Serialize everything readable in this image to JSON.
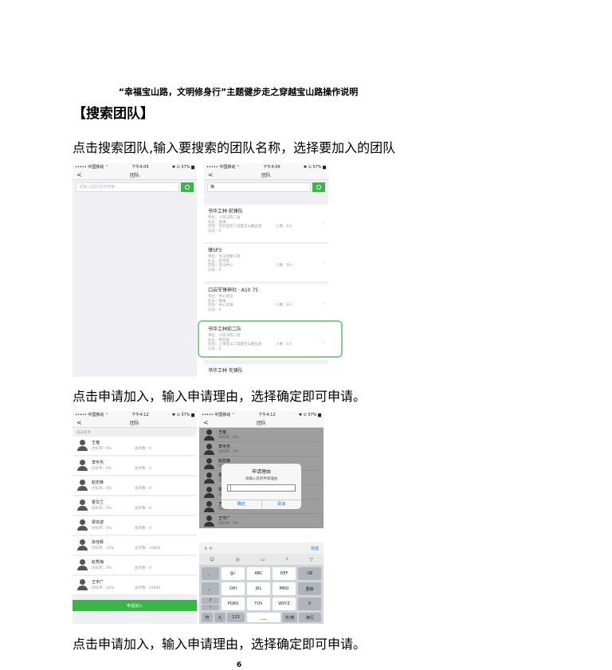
{
  "doc": {
    "title": "“幸福宝山路，文明修身行”主题健步走之穿越宝山路操作说明",
    "section_heading": "【搜索团队】",
    "para1": "点击搜索团队,输入要搜索的团队名称，选择要加入的团队",
    "para2": "点击申请加入，输入申请理由，选择确定即可申请。",
    "para3": "点击申请加入，输入申请理由，选择确定即可申请。",
    "page_number": "6"
  },
  "screen1": {
    "status_left": "••••• 中国移动 ⌃",
    "status_mid": "下午4:05",
    "status_right": "✱ ⊙ 57% ▆",
    "nav_title": "团队",
    "back": "<",
    "search_placeholder": "请输入团队名称搜索..."
  },
  "screen2": {
    "status_left": "••••• 中国移动 ⌃",
    "status_mid": "下午4:06",
    "status_right": "✱ ⊙ 57% ▆",
    "nav_title": "团队",
    "back": "<",
    "search_value": "锋",
    "teams": [
      {
        "name": "书华工林·前锋队",
        "l1": "单位：人民法院二会",
        "l2": "队长：张锋",
        "l3": "宗旨：走好全民二穿越宝山路出发",
        "l4": "口号：0",
        "count": "人数：0人"
      },
      {
        "name": "锋SP3",
        "l1": "单位：宝山团委三会",
        "l2": "队长：赵宇先",
        "l3": "宗旨：宝山中心",
        "l4": "口号：0",
        "count": "人数：0人"
      },
      {
        "name": "口岩军锋神社 · A10 75",
        "l1": "单位：中心会馆",
        "l2": "队长：锋锋",
        "l3": "宗旨：中心军锋",
        "l4": "口号：0",
        "count": "人数：0人"
      },
      {
        "name": "书华工林前二队",
        "l1": "单位：人民法院二会",
        "l2": "队长：林先锋",
        "l3": "宗旨：上海宝山二穿越宝山路出发",
        "l4": "口号：0",
        "count": "人数：0人"
      },
      {
        "name": "书华工林 先锋队",
        "l1": "",
        "l2": "",
        "l3": "",
        "l4": "",
        "count": ""
      }
    ]
  },
  "screen3": {
    "status_left": "••••• 中国移动 ⌃",
    "status_mid": "下午4:12",
    "status_right": "✱ ⊙ 57% ▆",
    "nav_title": "团队",
    "back": "<",
    "list_header": "成员名单",
    "members": [
      {
        "name": "王蓓",
        "done": "达标率：0%",
        "steps": "总步数：0"
      },
      {
        "name": "李宇杰",
        "done": "达标率：0%",
        "steps": "总步数：0"
      },
      {
        "name": "赵宏峰",
        "done": "达标率：0%",
        "steps": "总步数：0"
      },
      {
        "name": "曹文兰",
        "done": "达标率：0%",
        "steps": "总步数：0"
      },
      {
        "name": "梁宗波",
        "done": "达标率：0%",
        "steps": "总步数：0"
      },
      {
        "name": "张佳辉",
        "done": "达标率：33%",
        "steps": "总步数：10800"
      },
      {
        "name": "赵秀梅",
        "done": "达标率：0%",
        "steps": "总步数：0"
      },
      {
        "name": "王宇广",
        "done": "达标率：33%",
        "steps": "总步数：14892"
      }
    ],
    "apply_button": "申请加入"
  },
  "screen4": {
    "status_left": "••••• 中国移动 ⌃",
    "status_mid": "下午4:12",
    "status_right": "✱ ⊙ 57% ▆",
    "nav_title": "团队",
    "back": "<",
    "bg_members": [
      {
        "name": "王蓓",
        "done": "达标率：0%"
      },
      {
        "name": "李宇杰",
        "done": "达标率：0%"
      },
      {
        "name": "赵宏峰",
        "done": "达标率：0%"
      },
      {
        "name": "曹文兰",
        "done": "达标率：0%"
      },
      {
        "name": "梁宗波",
        "done": "达标率：0%"
      },
      {
        "name": "王宇广",
        "done": "达标率：0%"
      },
      {
        "name": "王宇广",
        "done": "达标率：0%"
      }
    ],
    "dialog_title": "申请理由",
    "dialog_hint": "请输入您的申请理由",
    "dialog_confirm": "确定",
    "dialog_cancel": "取消",
    "kb_done": "完成",
    "kb_arrows": "∧  ∨",
    "keys": {
      "k1": "，",
      "k2": "@/.",
      "k3": "ABC",
      "k4": "DEF",
      "k5": "⌫",
      "k6": "。",
      "k7": "GHI",
      "k8": "JKL",
      "k9": "MNO",
      "k10": "重输",
      "k11": "?",
      "k12": "PQRS",
      "k13": "TUV",
      "k14": "WXYZ",
      "k15": "0",
      "k16": "!",
      "b1": "符",
      "b2": "九",
      "b3": "123",
      "b4": "___",
      "b5": "中/英",
      "b6": "换行"
    }
  }
}
